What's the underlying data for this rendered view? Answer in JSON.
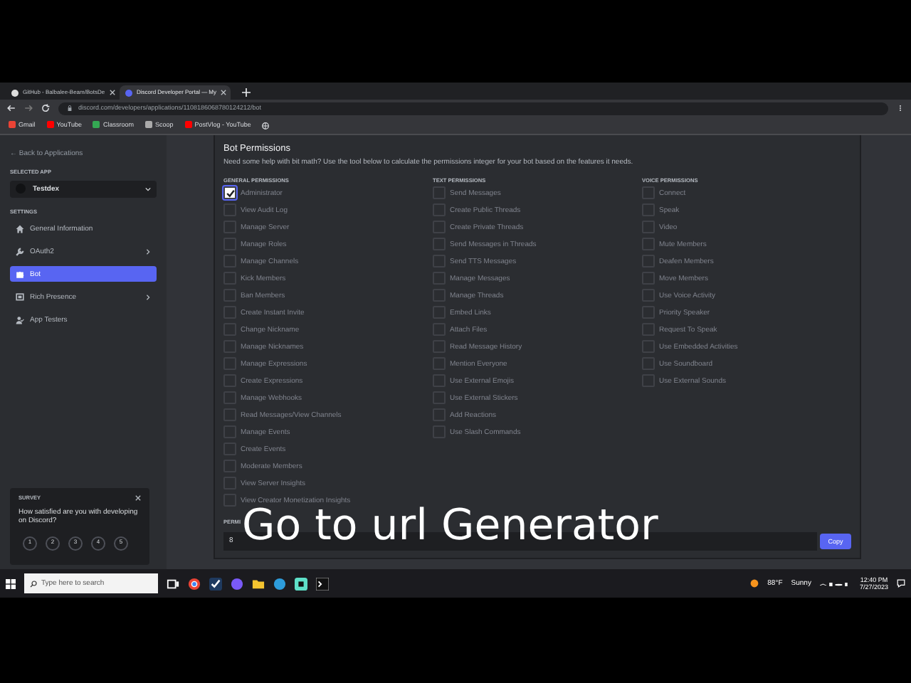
{
  "browser": {
    "tabs": [
      {
        "label": "GitHub - Balbalee-Beam/BotsDe",
        "selected": false
      },
      {
        "label": "Discord Developer Portal — My",
        "selected": true
      }
    ],
    "address": "discord.com/developers/applications/1108186068780124212/bot",
    "bookmarks": [
      "Gmail",
      "YouTube",
      "Classroom",
      "Scoop",
      "PostVlog - YouTube"
    ]
  },
  "sidebar": {
    "back_link": "← Back to Applications",
    "selected_app_label": "SELECTED APP",
    "app": "Testdex",
    "settings_label": "SETTINGS",
    "items": [
      {
        "label": "General Information",
        "selected": false,
        "expandable": false
      },
      {
        "label": "OAuth2",
        "selected": false,
        "expandable": true
      },
      {
        "label": "Bot",
        "selected": true,
        "expandable": false
      },
      {
        "label": "Rich Presence",
        "selected": false,
        "expandable": true
      },
      {
        "label": "App Testers",
        "selected": false,
        "expandable": false
      }
    ]
  },
  "survey": {
    "title": "SURVEY",
    "question": "How satisfied are you with developing on Discord?",
    "ratings": [
      "1",
      "2",
      "3",
      "4",
      "5"
    ]
  },
  "permissions": {
    "title": "Bot Permissions",
    "description": "Need some help with bit math? Use the tool below to calculate the permissions integer for your bot based on the features it needs.",
    "groups": [
      {
        "heading": "GENERAL PERMISSIONS",
        "items": [
          {
            "label": "Administrator",
            "checked": true
          },
          {
            "label": "View Audit Log",
            "checked": false
          },
          {
            "label": "Manage Server",
            "checked": false
          },
          {
            "label": "Manage Roles",
            "checked": false
          },
          {
            "label": "Manage Channels",
            "checked": false
          },
          {
            "label": "Kick Members",
            "checked": false
          },
          {
            "label": "Ban Members",
            "checked": false
          },
          {
            "label": "Create Instant Invite",
            "checked": false
          },
          {
            "label": "Change Nickname",
            "checked": false
          },
          {
            "label": "Manage Nicknames",
            "checked": false
          },
          {
            "label": "Manage Expressions",
            "checked": false
          },
          {
            "label": "Create Expressions",
            "checked": false
          },
          {
            "label": "Manage Webhooks",
            "checked": false
          },
          {
            "label": "Read Messages/View Channels",
            "checked": false
          },
          {
            "label": "Manage Events",
            "checked": false
          },
          {
            "label": "Create Events",
            "checked": false
          },
          {
            "label": "Moderate Members",
            "checked": false
          },
          {
            "label": "View Server Insights",
            "checked": false
          },
          {
            "label": "View Creator Monetization Insights",
            "checked": false
          }
        ]
      },
      {
        "heading": "TEXT PERMISSIONS",
        "items": [
          {
            "label": "Send Messages",
            "checked": false
          },
          {
            "label": "Create Public Threads",
            "checked": false
          },
          {
            "label": "Create Private Threads",
            "checked": false
          },
          {
            "label": "Send Messages in Threads",
            "checked": false
          },
          {
            "label": "Send TTS Messages",
            "checked": false
          },
          {
            "label": "Manage Messages",
            "checked": false
          },
          {
            "label": "Manage Threads",
            "checked": false
          },
          {
            "label": "Embed Links",
            "checked": false
          },
          {
            "label": "Attach Files",
            "checked": false
          },
          {
            "label": "Read Message History",
            "checked": false
          },
          {
            "label": "Mention Everyone",
            "checked": false
          },
          {
            "label": "Use External Emojis",
            "checked": false
          },
          {
            "label": "Use External Stickers",
            "checked": false
          },
          {
            "label": "Add Reactions",
            "checked": false
          },
          {
            "label": "Use Slash Commands",
            "checked": false
          }
        ]
      },
      {
        "heading": "VOICE PERMISSIONS",
        "items": [
          {
            "label": "Connect",
            "checked": false
          },
          {
            "label": "Speak",
            "checked": false
          },
          {
            "label": "Video",
            "checked": false
          },
          {
            "label": "Mute Members",
            "checked": false
          },
          {
            "label": "Deafen Members",
            "checked": false
          },
          {
            "label": "Move Members",
            "checked": false
          },
          {
            "label": "Use Voice Activity",
            "checked": false
          },
          {
            "label": "Priority Speaker",
            "checked": false
          },
          {
            "label": "Request To Speak",
            "checked": false
          },
          {
            "label": "Use Embedded Activities",
            "checked": false
          },
          {
            "label": "Use Soundboard",
            "checked": false
          },
          {
            "label": "Use External Sounds",
            "checked": false
          }
        ]
      }
    ],
    "integer_label": "PERMI",
    "integer_value": "8",
    "copy_button": "Copy"
  },
  "caption": "Go to url Generator",
  "taskbar": {
    "search_placeholder": "Type here to search",
    "temperature": "88°F",
    "condition": "Sunny",
    "time": "12:40 PM",
    "date": "7/27/2023"
  }
}
